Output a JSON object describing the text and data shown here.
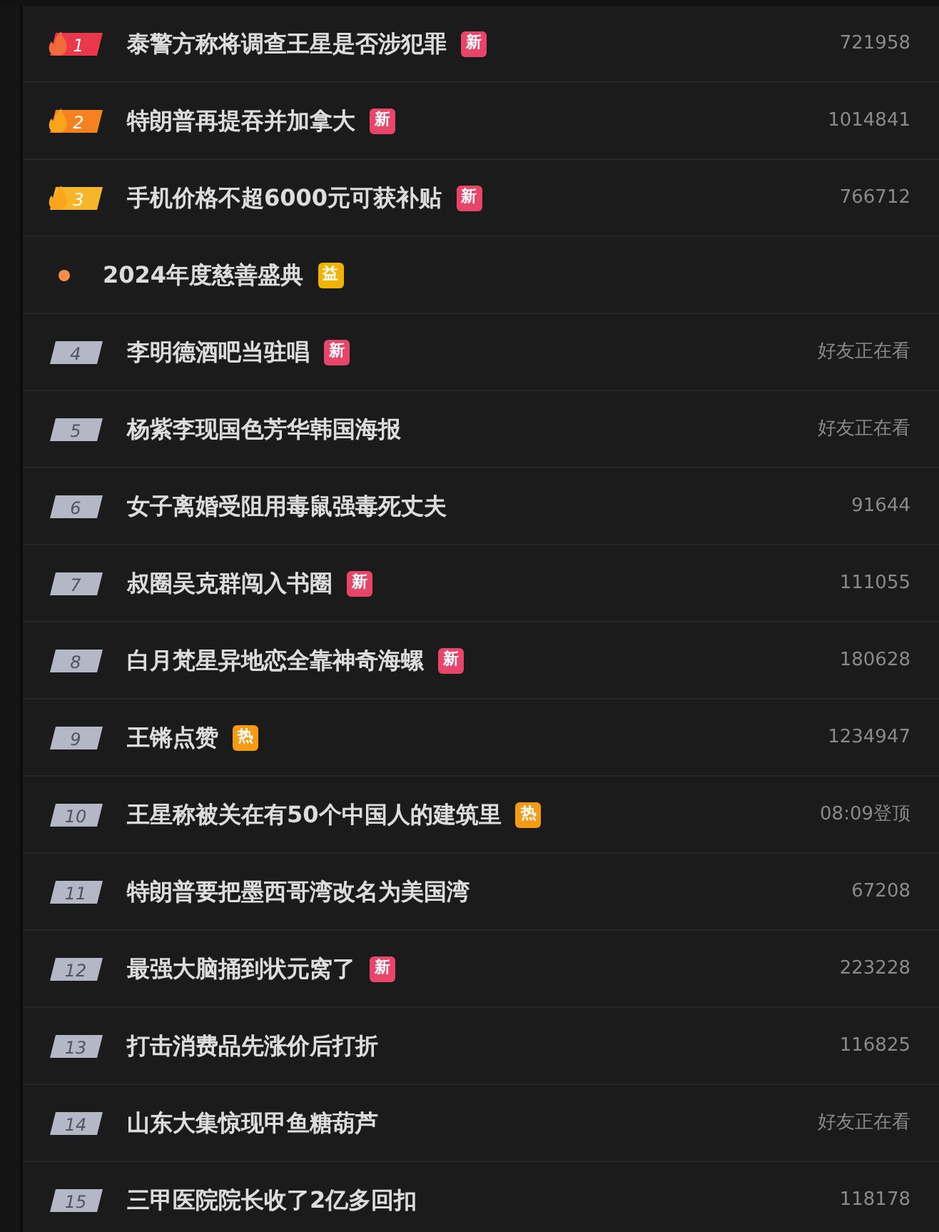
{
  "hot_list": [
    {
      "kind": "top",
      "rank": "1",
      "color": "#e8384a",
      "title": "泰警方称将调查王星是否涉犯罪",
      "tag": {
        "text": "新",
        "color": "#e8456b"
      },
      "metric": "721958"
    },
    {
      "kind": "top",
      "rank": "2",
      "color": "#f5821f",
      "title": "特朗普再提吞并加拿大",
      "tag": {
        "text": "新",
        "color": "#e8456b"
      },
      "metric": "1014841"
    },
    {
      "kind": "top",
      "rank": "3",
      "color": "#f7b52a",
      "title": "手机价格不超6000元可获补贴",
      "tag": {
        "text": "新",
        "color": "#e8456b"
      },
      "metric": "766712"
    },
    {
      "kind": "promoted",
      "title": "2024年度慈善盛典",
      "tag": {
        "text": "益",
        "color": "#f0b400"
      }
    },
    {
      "kind": "ranked",
      "rank": "4",
      "title": "李明德酒吧当驻唱",
      "tag": {
        "text": "新",
        "color": "#e8456b"
      },
      "metric": "好友正在看"
    },
    {
      "kind": "ranked",
      "rank": "5",
      "title": "杨紫李现国色芳华韩国海报",
      "metric": "好友正在看"
    },
    {
      "kind": "ranked",
      "rank": "6",
      "title": "女子离婚受阻用毒鼠强毒死丈夫",
      "metric": "91644"
    },
    {
      "kind": "ranked",
      "rank": "7",
      "title": "叔圈吴克群闯入书圈",
      "tag": {
        "text": "新",
        "color": "#e8456b"
      },
      "metric": "111055"
    },
    {
      "kind": "ranked",
      "rank": "8",
      "title": "白月梵星异地恋全靠神奇海螺",
      "tag": {
        "text": "新",
        "color": "#e8456b"
      },
      "metric": "180628"
    },
    {
      "kind": "ranked",
      "rank": "9",
      "title": "王锵点赞",
      "tag": {
        "text": "热",
        "color": "#f59a14"
      },
      "metric": "1234947"
    },
    {
      "kind": "ranked",
      "rank": "10",
      "title": "王星称被关在有50个中国人的建筑里",
      "tag": {
        "text": "热",
        "color": "#f59a14"
      },
      "metric": "08:09登顶"
    },
    {
      "kind": "ranked",
      "rank": "11",
      "title": "特朗普要把墨西哥湾改名为美国湾",
      "metric": "67208"
    },
    {
      "kind": "ranked",
      "rank": "12",
      "title": "最强大脑捅到状元窝了",
      "tag": {
        "text": "新",
        "color": "#e8456b"
      },
      "metric": "223228"
    },
    {
      "kind": "ranked",
      "rank": "13",
      "title": "打击消费品先涨价后打折",
      "metric": "116825"
    },
    {
      "kind": "ranked",
      "rank": "14",
      "title": "山东大集惊现甲鱼糖葫芦",
      "metric": "好友正在看"
    },
    {
      "kind": "ranked",
      "rank": "15",
      "title": "三甲医院院长收了2亿多回扣",
      "metric": "118178"
    }
  ]
}
